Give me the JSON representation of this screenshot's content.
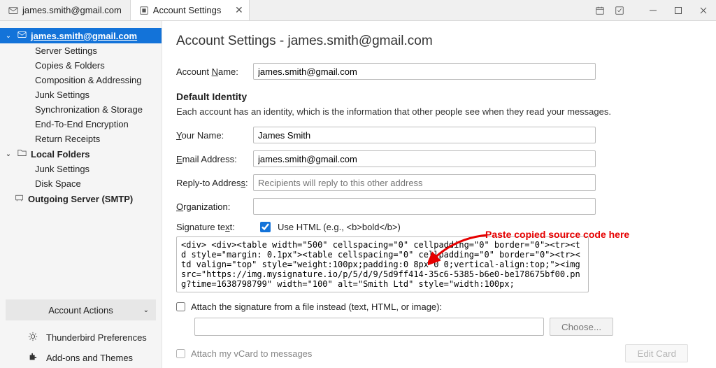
{
  "tabs": {
    "mail": "james.smith@gmail.com",
    "settings": "Account Settings"
  },
  "sidebar": {
    "account": "james.smith@gmail.com",
    "items": [
      "Server Settings",
      "Copies & Folders",
      "Composition & Addressing",
      "Junk Settings",
      "Synchronization & Storage",
      "End-To-End Encryption",
      "Return Receipts"
    ],
    "local": "Local Folders",
    "local_items": [
      "Junk Settings",
      "Disk Space"
    ],
    "smtp": "Outgoing Server (SMTP)",
    "account_actions": "Account Actions",
    "prefs": "Thunderbird Preferences",
    "addons": "Add-ons and Themes"
  },
  "page": {
    "title": "Account Settings - james.smith@gmail.com",
    "account_name_label_pre": "Account ",
    "account_name_label_u": "N",
    "account_name_label_post": "ame:",
    "account_name": "james.smith@gmail.com",
    "identity_heading": "Default Identity",
    "identity_desc": "Each account has an identity, which is the information that other people see when they read your messages.",
    "your_name_label_u": "Y",
    "your_name_label_post": "our Name:",
    "your_name": "James Smith",
    "email_label_u": "E",
    "email_label_post": "mail Address:",
    "email": "james.smith@gmail.com",
    "reply_label": "Reply-to Addres",
    "reply_label_u": "s",
    "reply_label_post": ":",
    "reply_placeholder": "Recipients will reply to this other address",
    "org_label_u": "O",
    "org_label_post": "rganization:",
    "sig_label": "Signature te",
    "sig_label_u": "x",
    "sig_label_post": "t:",
    "use_html": "Use HTML (e.g., <b>bold</b>)",
    "sig_text": "<div> <div><table width=\"500\" cellspacing=\"0\" cellpadding=\"0\" border=\"0\"><tr><td style=\"margin: 0.1px\"><table cellspacing=\"0\" cellpadding=\"0\" border=\"0\"><tr><td valign=\"top\" style=\"weight:100px;padding:0 8px 0 0;vertical-align:top;\"><img src=\"https://img.mysignature.io/p/5/d/9/5d9ff414-35c6-5385-b6e0-be178675bf00.png?time=1638798799\" width=\"100\" alt=\"Smith Ltd\" style=\"width:100px;",
    "attach_label": "Attach the signature from a file instead (text, HTML, or image):",
    "choose": "Choose...",
    "vcard_label": "Attach my vCard to messages",
    "edit_card": "Edit Card",
    "annotation": "Paste copied source code here"
  }
}
